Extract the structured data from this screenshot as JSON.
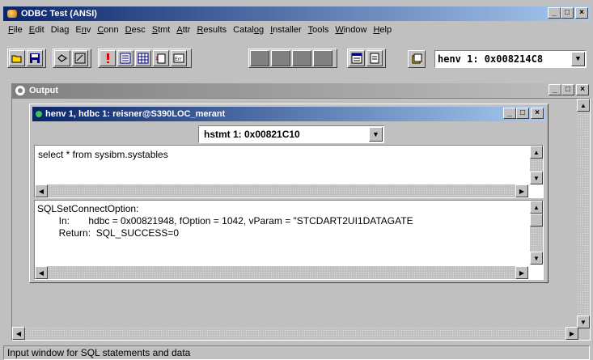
{
  "app": {
    "title": "ODBC Test (ANSI)"
  },
  "menu": [
    {
      "pre": "",
      "ul": "F",
      "post": "ile"
    },
    {
      "pre": "",
      "ul": "E",
      "post": "dit"
    },
    {
      "pre": "Dia",
      "ul": "g",
      "post": ""
    },
    {
      "pre": "E",
      "ul": "n",
      "post": "v"
    },
    {
      "pre": "",
      "ul": "C",
      "post": "onn"
    },
    {
      "pre": "",
      "ul": "D",
      "post": "esc"
    },
    {
      "pre": "",
      "ul": "S",
      "post": "tmt"
    },
    {
      "pre": "",
      "ul": "A",
      "post": "ttr"
    },
    {
      "pre": "",
      "ul": "R",
      "post": "esults"
    },
    {
      "pre": "Catal",
      "ul": "o",
      "post": "g"
    },
    {
      "pre": "",
      "ul": "I",
      "post": "nstaller"
    },
    {
      "pre": "",
      "ul": "T",
      "post": "ools"
    },
    {
      "pre": "",
      "ul": "W",
      "post": "indow"
    },
    {
      "pre": "",
      "ul": "H",
      "post": "elp"
    }
  ],
  "toolbar": {
    "henv_selected": "henv 1: 0x008214C8"
  },
  "output": {
    "title": "Output"
  },
  "child": {
    "title": "henv 1, hdbc 1: reisner@S390LOC_merant",
    "hstmt_selected": "hstmt 1: 0x00821C10",
    "input_text": "select * from sysibm.systables",
    "result_lines": [
      "SQLSetConnectOption:",
      "        In:       hdbc = 0x00821948, fOption = 1042, vParam = \"STCDART2UI1DATAGATE",
      "        Return:  SQL_SUCCESS=0"
    ]
  },
  "status": {
    "text": "Input window for SQL statements and data"
  },
  "colors": {
    "title_active": "#0a246a",
    "title_inactive": "#808080",
    "face": "#c0c0c0"
  }
}
